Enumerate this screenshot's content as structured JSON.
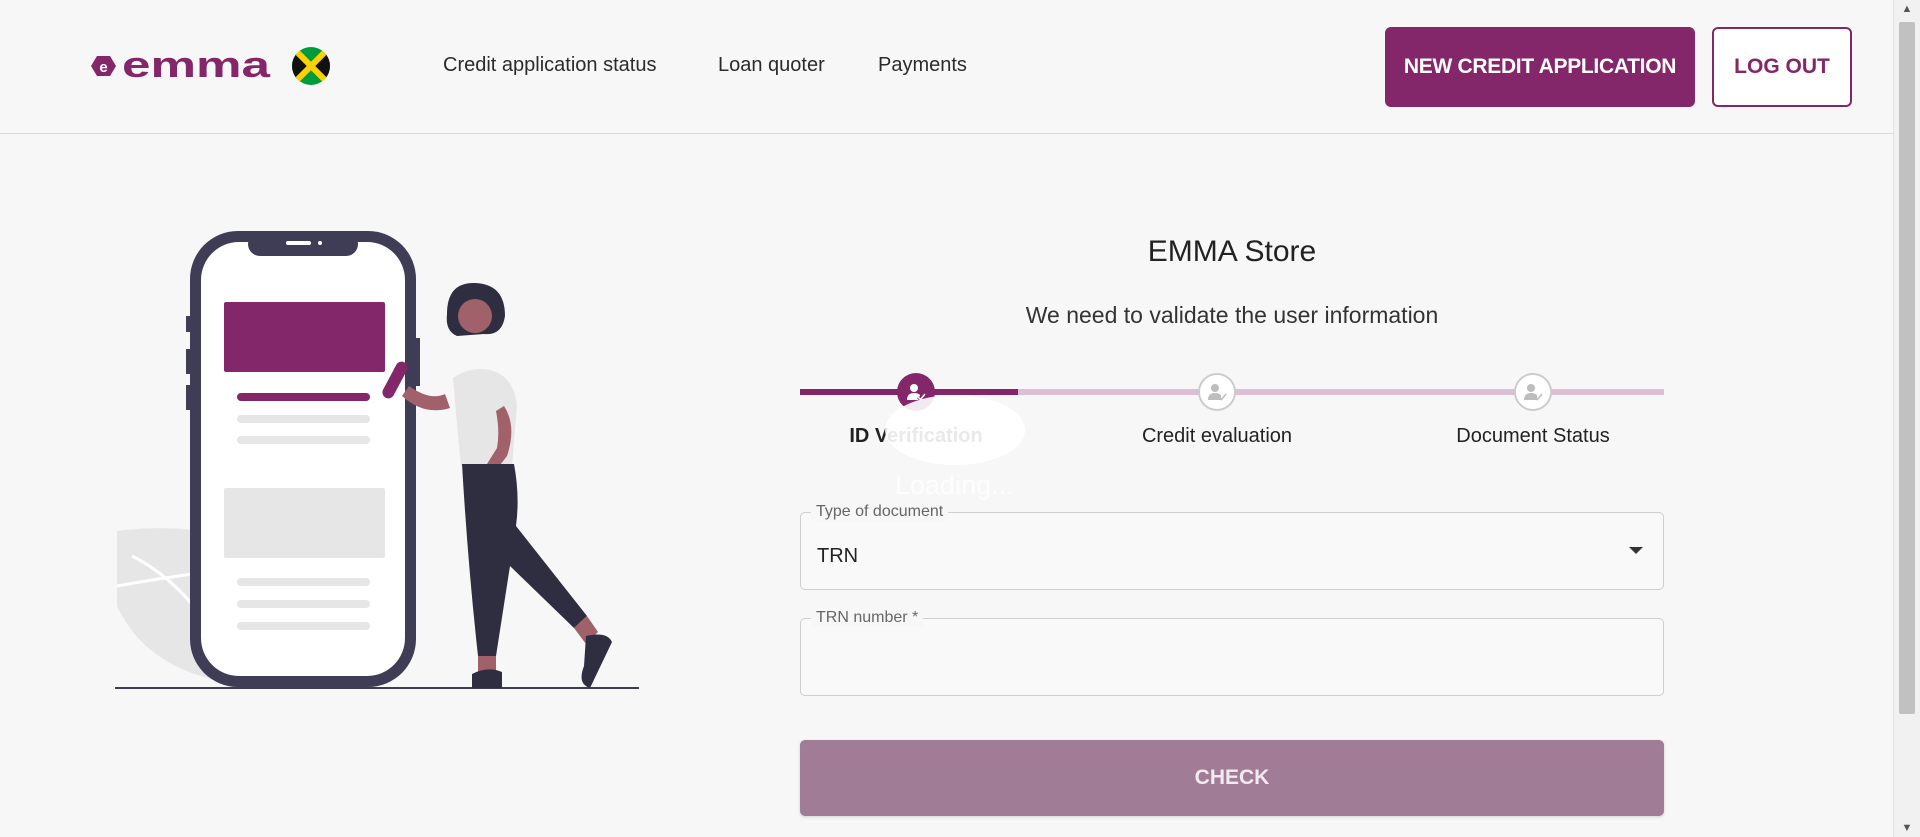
{
  "header": {
    "logo_text": "emma",
    "nav": [
      {
        "label": "Credit application status"
      },
      {
        "label": "Loan quoter"
      },
      {
        "label": "Payments"
      }
    ],
    "new_application_label": "NEW CREDIT APPLICATION",
    "logout_label": "LOG OUT"
  },
  "main": {
    "store_title": "EMMA Store",
    "subtitle": "We need to validate the user information",
    "steps": [
      {
        "label": "ID Verification",
        "state": "active"
      },
      {
        "label": "Credit evaluation",
        "state": "pending"
      },
      {
        "label": "Document Status",
        "state": "pending"
      }
    ],
    "loading_text": "Loading...",
    "document_type": {
      "label": "Type of document",
      "value": "TRN"
    },
    "trn_number": {
      "label": "TRN number *",
      "value": ""
    },
    "check_label": "CHECK"
  },
  "colors": {
    "brand": "#84266a",
    "brand_light": "#dcbfd3",
    "check_button": "#a07c96"
  },
  "icons": {
    "flag": "jamaica-flag-icon",
    "step": "user-check-icon",
    "select": "caret-down-icon"
  }
}
